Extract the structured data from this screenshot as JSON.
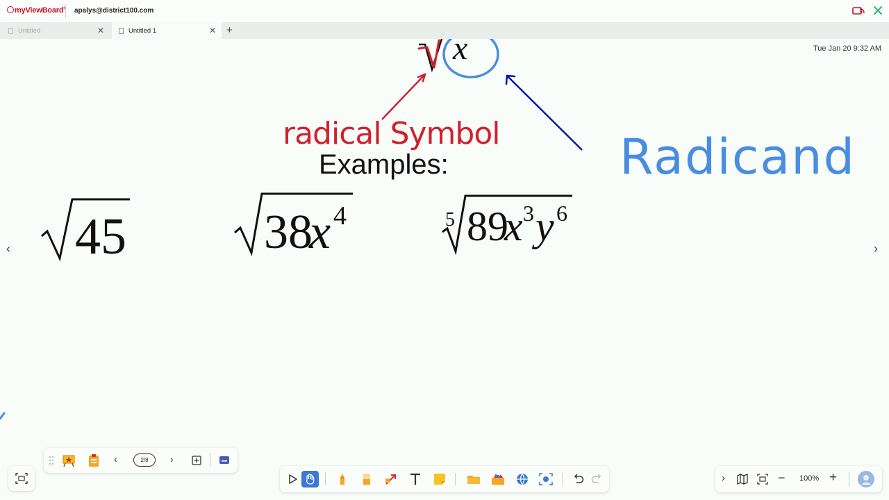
{
  "app": {
    "logo_text": "myViewBoard",
    "account": "apalys@district100.com"
  },
  "tabs": [
    {
      "label": "Untitled",
      "active": false
    },
    {
      "label": "Untitled 1",
      "active": true
    }
  ],
  "clock": "Tue Jan 20 9:32 AM",
  "whiteboard": {
    "annotation_red": "radical Symbol",
    "annotation_blue": "Radicand",
    "heading": "Examples:",
    "top_radicand": "x",
    "examples": [
      {
        "index": "",
        "radicand": "45"
      },
      {
        "index": "",
        "radicand_num": "38",
        "var1": "x",
        "exp1": "4"
      },
      {
        "index": "5",
        "radicand_num": "89",
        "var1": "x",
        "exp1": "3",
        "var2": "y",
        "exp2": "6"
      }
    ],
    "colors": {
      "red_ink": "#d0202e",
      "blue_ink": "#4a8de0",
      "dark_blue_ink": "#0a14a8",
      "background": "#f9fdf9"
    }
  },
  "left_toolbar": {
    "page_indicator": "2/8",
    "icons": [
      "drag-handle-icon",
      "presentation-icon",
      "clipboard-icon",
      "chevron-left-icon",
      "chevron-right-icon",
      "add-page-icon",
      "keyboard-icon"
    ]
  },
  "main_toolbar": {
    "icons": [
      "select-icon",
      "hand-icon",
      "pen-icon",
      "eraser-icon",
      "shape-arrow-icon",
      "text-icon",
      "sticky-note-icon",
      "folder-icon",
      "tool-box-icon",
      "globe-icon",
      "screenshot-icon",
      "undo-icon",
      "redo-icon"
    ]
  },
  "zoom_toolbar": {
    "zoom_level": "100%",
    "icons": [
      "collapse-icon",
      "map-icon",
      "fit-screen-icon",
      "zoom-out-icon",
      "zoom-in-icon",
      "avatar-icon"
    ]
  }
}
